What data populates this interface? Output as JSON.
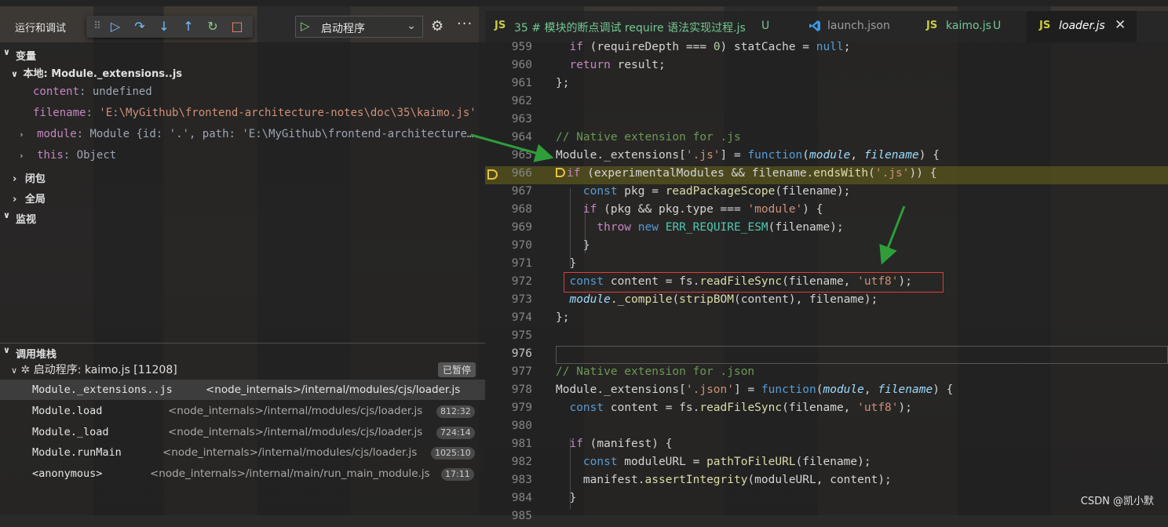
{
  "toolbar": {
    "title": "运行和调试",
    "launch_config": "启动程序"
  },
  "variables": {
    "header": "变量",
    "local_scope": "本地: Module._extensions..js",
    "items": [
      {
        "name": "content",
        "sep": ": ",
        "value": "undefined"
      },
      {
        "name": "filename",
        "sep": ": ",
        "value": "'E:\\MyGithub\\frontend-architecture-notes\\doc\\35\\kaimo.js'"
      },
      {
        "name": "module",
        "sep": ": ",
        "value": "Module {id: '.', path: 'E:\\MyGithub\\frontend-architecture…"
      },
      {
        "name": "this",
        "sep": ": ",
        "value": "Object"
      }
    ],
    "closure": "闭包",
    "global": "全局"
  },
  "watch": {
    "header": "监视"
  },
  "callstack": {
    "header": "调用堆栈",
    "session": "启动程序: kaimo.js [11208]",
    "status": "已暂停",
    "frames": [
      {
        "fn": "Module._extensions..js",
        "src": "<node_internals>/internal/modules/cjs/loader.js",
        "pos": ""
      },
      {
        "fn": "Module.load",
        "src": "<node_internals>/internal/modules/cjs/loader.js",
        "pos": "812:32"
      },
      {
        "fn": "Module._load",
        "src": "<node_internals>/internal/modules/cjs/loader.js",
        "pos": "724:14"
      },
      {
        "fn": "Module.runMain",
        "src": "<node_internals>/internal/modules/cjs/loader.js",
        "pos": "1025:10"
      },
      {
        "fn": "<anonymous>",
        "src": "<node_internals>/internal/main/run_main_module.js",
        "pos": "17:11"
      }
    ]
  },
  "tabs": [
    {
      "icon": "JS",
      "label": "35 # 模块的断点调试 require 语法实现过程.js",
      "badge": "U"
    },
    {
      "icon": "vscode",
      "label": "launch.json",
      "badge": ""
    },
    {
      "icon": "JS",
      "label": "kaimo.js",
      "badge": "U"
    },
    {
      "icon": "JS",
      "label": "loader.js",
      "badge": ""
    }
  ],
  "line_numbers": [
    "959",
    "960",
    "961",
    "962",
    "963",
    "964",
    "965",
    "966",
    "967",
    "968",
    "969",
    "970",
    "971",
    "972",
    "973",
    "974",
    "975",
    "976",
    "977",
    "978",
    "979",
    "980",
    "981",
    "982",
    "983",
    "984",
    "985"
  ],
  "watermark": "CSDN @凯小默",
  "colors": {
    "accent_yellow": "#e8c33b",
    "red_box": "#e03b3b",
    "arrow_green": "#2e9d3a"
  }
}
